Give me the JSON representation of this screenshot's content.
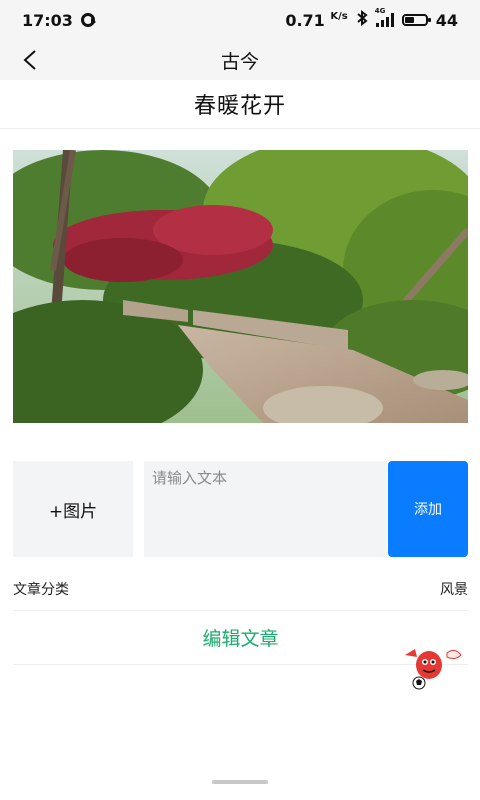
{
  "status_bar": {
    "time": "17:03",
    "speed_value": "0.71",
    "speed_unit": "K/s",
    "network_tag": "4G",
    "battery": "44"
  },
  "nav": {
    "title": "古今"
  },
  "article": {
    "title": "春暖花开"
  },
  "editor": {
    "add_image_label": "+图片",
    "text_placeholder": "请输入文本",
    "text_value": "",
    "add_button_label": "添加"
  },
  "category": {
    "label": "文章分类",
    "value": "风景"
  },
  "edit_article_label": "编辑文章",
  "colors": {
    "accent_blue": "#0a7cff",
    "accent_green": "#1aad6c"
  }
}
